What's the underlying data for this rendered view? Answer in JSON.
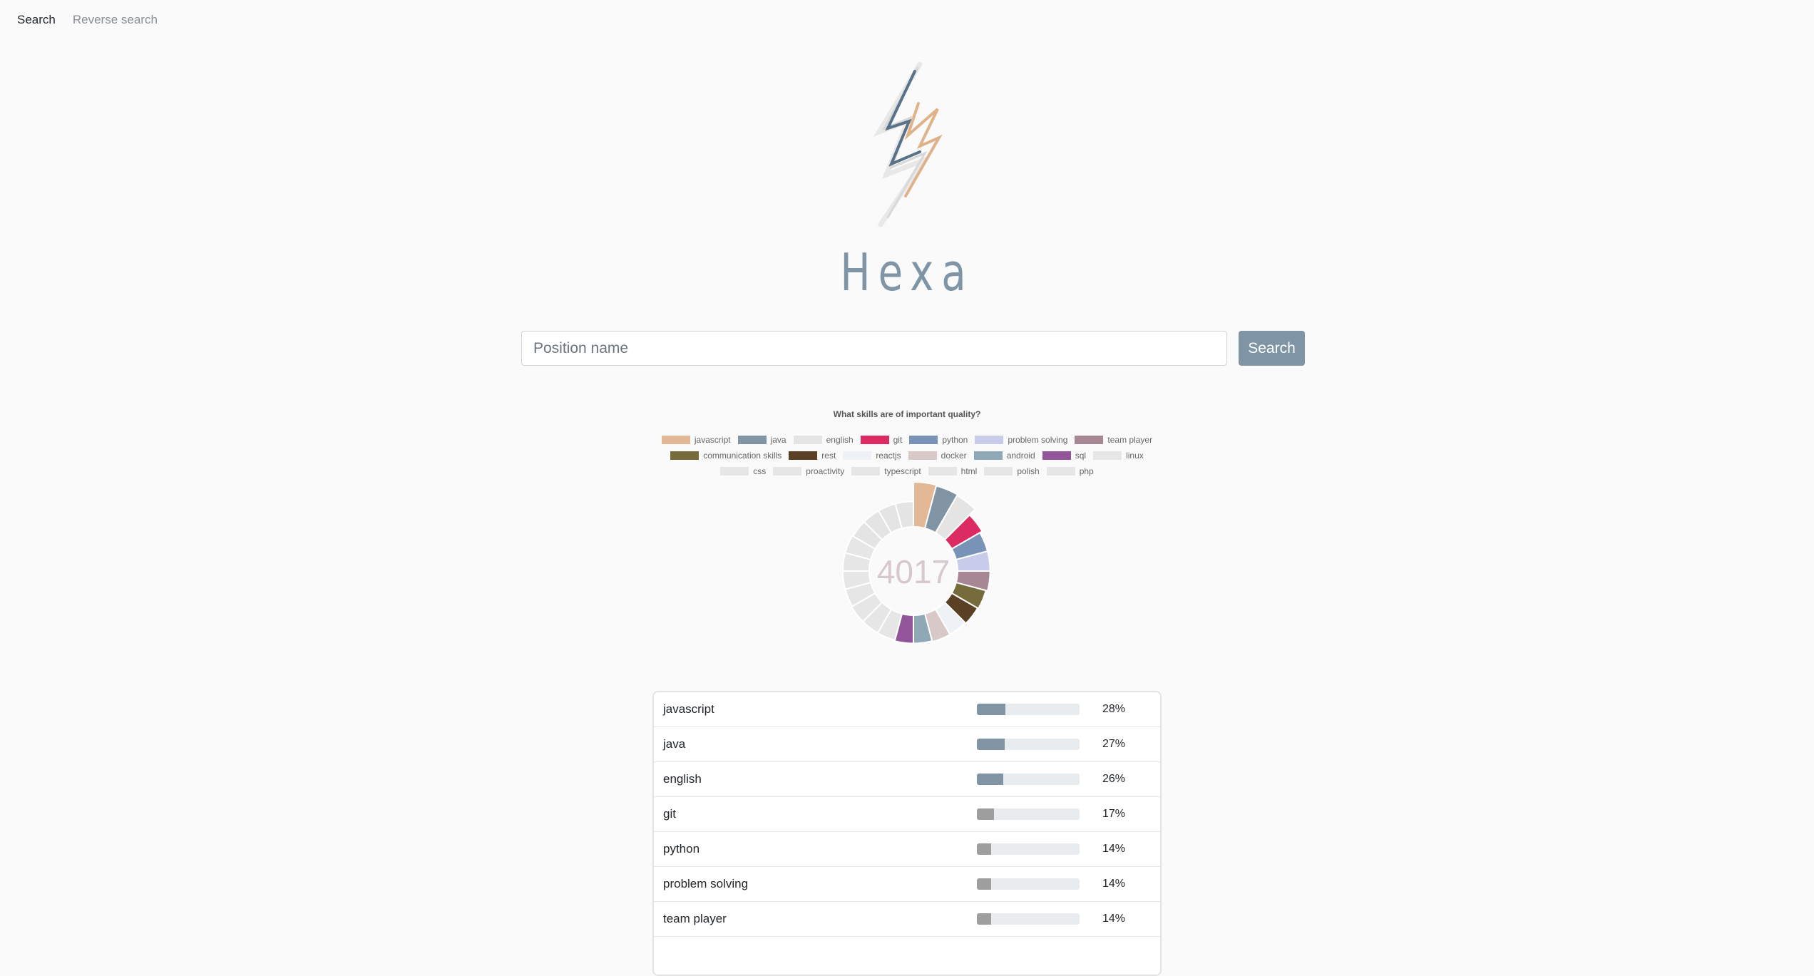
{
  "nav": {
    "search_label": "Search",
    "reverse_label": "Reverse search"
  },
  "brand": {
    "name": "Hexa"
  },
  "search": {
    "placeholder": "Position name",
    "button_label": "Search"
  },
  "chart_data": {
    "type": "pie",
    "title": "What skills are of important quality?",
    "center_label": "4017",
    "legend": [
      {
        "name": "javascript",
        "color": "#e2b896"
      },
      {
        "name": "java",
        "color": "#8194a4"
      },
      {
        "name": "english",
        "color": "#e4e4e4"
      },
      {
        "name": "git",
        "color": "#dc2b63"
      },
      {
        "name": "python",
        "color": "#7993b6"
      },
      {
        "name": "problem solving",
        "color": "#c8cbea"
      },
      {
        "name": "team player",
        "color": "#a78794"
      },
      {
        "name": "communication skills",
        "color": "#766b3b"
      },
      {
        "name": "rest",
        "color": "#5a4025"
      },
      {
        "name": "reactjs",
        "color": "#eef1f5"
      },
      {
        "name": "docker",
        "color": "#d8c8c8"
      },
      {
        "name": "android",
        "color": "#8fa8b6"
      },
      {
        "name": "sql",
        "color": "#92559a"
      },
      {
        "name": "linux",
        "color": "#e6e6e6"
      },
      {
        "name": "css",
        "color": "#e6e6e6"
      },
      {
        "name": "proactivity",
        "color": "#e6e6e6"
      },
      {
        "name": "typescript",
        "color": "#e6e6e6"
      },
      {
        "name": "html",
        "color": "#e6e6e6"
      },
      {
        "name": "polish",
        "color": "#e6e6e6"
      },
      {
        "name": "php",
        "color": "#e6e6e6"
      }
    ],
    "legend_rows": [
      [
        0,
        1,
        2,
        3,
        4,
        5,
        6
      ],
      [
        7,
        8,
        9,
        10,
        11,
        12,
        13
      ],
      [
        14,
        15,
        16,
        17,
        18,
        19
      ]
    ],
    "values": [
      28,
      27,
      26,
      17,
      14,
      14,
      14,
      12,
      11,
      10,
      10,
      9,
      9,
      8,
      8,
      8,
      7,
      7,
      7,
      7,
      6,
      6,
      6,
      6
    ]
  },
  "skills_table": {
    "rows": [
      {
        "name": "javascript",
        "pct": "28%",
        "value": 28,
        "color": "#8194a4"
      },
      {
        "name": "java",
        "pct": "27%",
        "value": 27,
        "color": "#8194a4"
      },
      {
        "name": "english",
        "pct": "26%",
        "value": 26,
        "color": "#8194a4"
      },
      {
        "name": "git",
        "pct": "17%",
        "value": 17,
        "color": "#9e9e9e"
      },
      {
        "name": "python",
        "pct": "14%",
        "value": 14,
        "color": "#9e9e9e"
      },
      {
        "name": "problem solving",
        "pct": "14%",
        "value": 14,
        "color": "#9e9e9e"
      },
      {
        "name": "team player",
        "pct": "14%",
        "value": 14,
        "color": "#9e9e9e"
      }
    ]
  }
}
